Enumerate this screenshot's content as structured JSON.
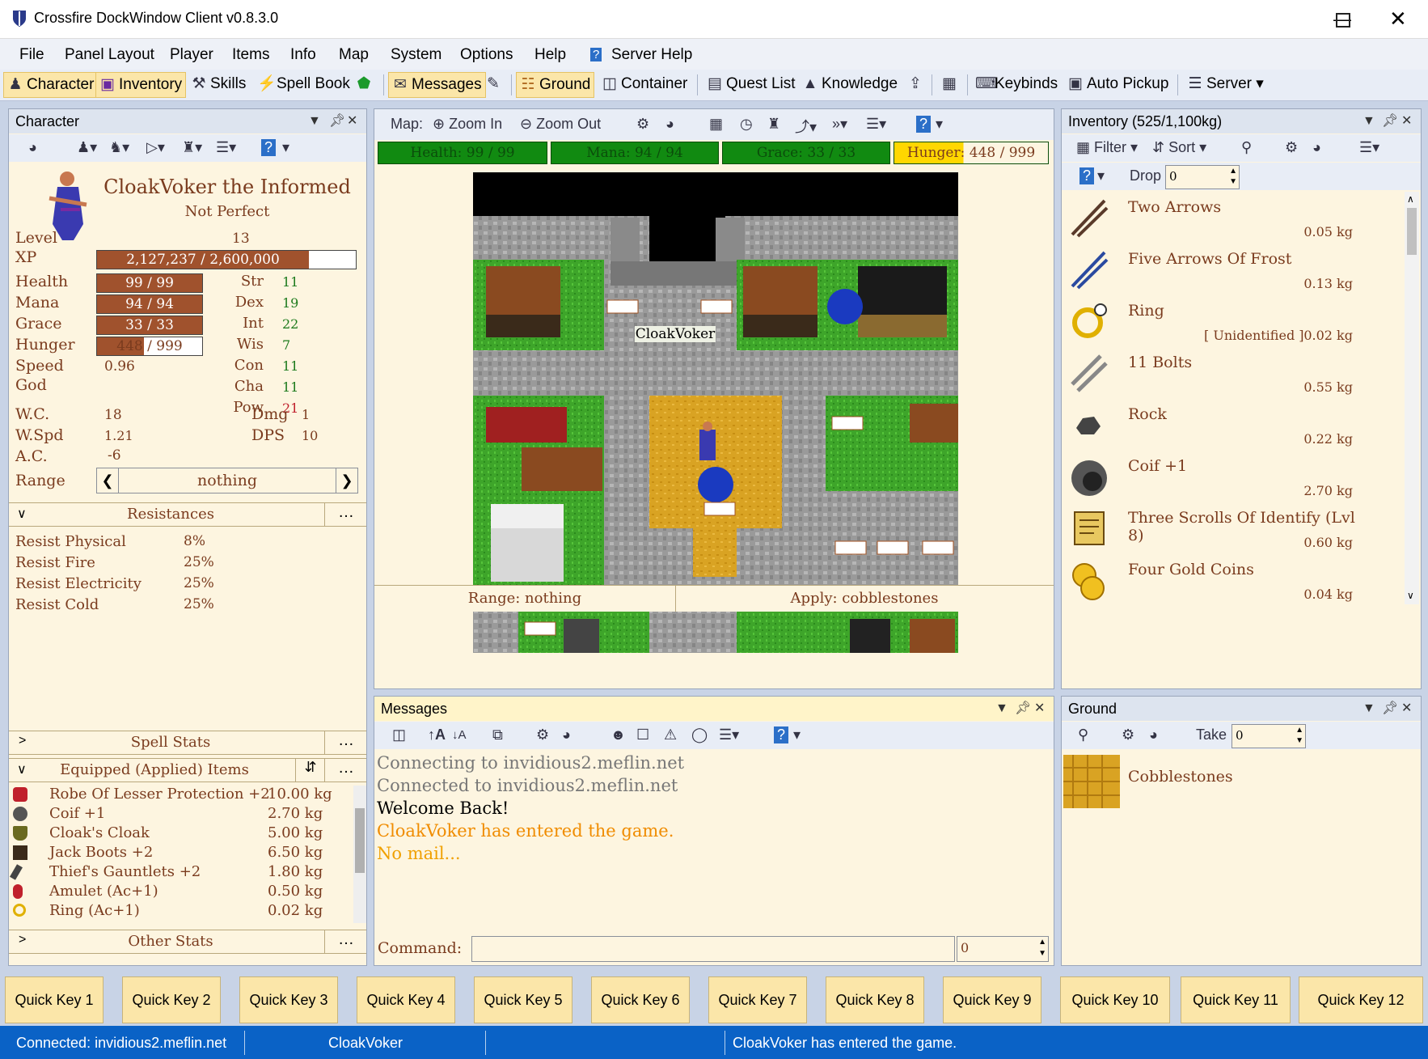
{
  "window": {
    "title": "Crossfire DockWindow Client v0.8.3.0"
  },
  "menu": [
    "File",
    "Panel Layout",
    "Player",
    "Items",
    "Info",
    "Map",
    "System",
    "Options",
    "Help",
    "Server Help"
  ],
  "toolbar": {
    "character": "Character",
    "inventory": "Inventory",
    "skills": "Skills",
    "spellbook": "Spell Book",
    "messages": "Messages",
    "ground": "Ground",
    "container": "Container",
    "quest": "Quest List",
    "knowledge": "Knowledge",
    "keybinds": "Keybinds",
    "autopickup": "Auto Pickup",
    "server": "Server"
  },
  "character": {
    "panel_title": "Character",
    "name": "CloakVoker the Informed",
    "subtitle": "Not Perfect",
    "level_label": "Level",
    "level": "13",
    "xp_label": "XP",
    "xp": "2,127,237 / 2,600,000",
    "xp_fraction": 0.818,
    "health_label": "Health",
    "health": "99 / 99",
    "health_fraction": 1.0,
    "mana_label": "Mana",
    "mana": "94 / 94",
    "mana_fraction": 1.0,
    "grace_label": "Grace",
    "grace": "33 / 33",
    "grace_fraction": 1.0,
    "hunger_label": "Hunger",
    "hunger": "448 / 999",
    "hunger_fraction": 0.448,
    "speed_label": "Speed",
    "speed": "0.96",
    "god_label": "God",
    "stats": [
      {
        "label": "Str",
        "value": "11"
      },
      {
        "label": "Dex",
        "value": "19"
      },
      {
        "label": "Int",
        "value": "22"
      },
      {
        "label": "Wis",
        "value": "7"
      },
      {
        "label": "Con",
        "value": "11"
      },
      {
        "label": "Cha",
        "value": "11"
      },
      {
        "label": "Pow",
        "value": "21"
      }
    ],
    "wc_label": "W.C.",
    "wc": "18",
    "wspd_label": "W.Spd",
    "wspd": "1.21",
    "ac_label": "A.C.",
    "ac": "-6",
    "dmg_label": "Dmg",
    "dmg": "1",
    "dps_label": "DPS",
    "dps": "10",
    "range_label": "Range",
    "range": "nothing",
    "resistances_title": "Resistances",
    "resistances": [
      {
        "name": "Resist Physical",
        "value": "8%"
      },
      {
        "name": "Resist Fire",
        "value": "25%"
      },
      {
        "name": "Resist Electricity",
        "value": "25%"
      },
      {
        "name": "Resist Cold",
        "value": "25%"
      }
    ],
    "spell_stats": "Spell Stats",
    "equipped_title": "Equipped (Applied) Items",
    "equipped": [
      {
        "name": "Robe Of Lesser Protection +2",
        "weight": "10.00 kg"
      },
      {
        "name": "Coif +1",
        "weight": "2.70 kg"
      },
      {
        "name": "Cloak's Cloak",
        "weight": "5.00 kg"
      },
      {
        "name": "Jack Boots +2",
        "weight": "6.50 kg"
      },
      {
        "name": "Thief's Gauntlets +2",
        "weight": "1.80 kg"
      },
      {
        "name": "Amulet (Ac+1)",
        "weight": "0.50 kg"
      },
      {
        "name": "Ring (Ac+1)",
        "weight": "0.02 kg"
      }
    ],
    "other_stats": "Other Stats",
    "more": "…"
  },
  "map": {
    "label": "Map:",
    "zoom_in": "Zoom In",
    "zoom_out": "Zoom Out",
    "bars": [
      {
        "label": "Health:",
        "value": "99 / 99"
      },
      {
        "label": "Mana:",
        "value": "94 / 94"
      },
      {
        "label": "Grace:",
        "value": "33 / 33"
      },
      {
        "label": "Hunger:",
        "value": "448 / 999"
      }
    ],
    "player_name": "CloakVoker",
    "range": "Range: nothing",
    "apply": "Apply: cobblestones"
  },
  "messages": {
    "title": "Messages",
    "lines": [
      {
        "text": "Connecting to invidious2.meflin.net",
        "color": "#777777"
      },
      {
        "text": "Connected to invidious2.meflin.net",
        "color": "#777777"
      },
      {
        "text": "Welcome Back!",
        "color": "#000000"
      },
      {
        "text": "CloakVoker has entered the game.",
        "color": "#f08c00"
      },
      {
        "text": "No mail...",
        "color": "#f0a000"
      }
    ],
    "command_label": "Command:",
    "command_count": "0"
  },
  "inventory": {
    "title": "Inventory (525/1,100kg)",
    "filter": "Filter",
    "sort": "Sort",
    "drop": "Drop",
    "drop_count": "0",
    "items": [
      {
        "name": "Two Arrows",
        "weight": "0.05 kg",
        "note": ""
      },
      {
        "name": "Five Arrows Of Frost",
        "weight": "0.13 kg",
        "note": ""
      },
      {
        "name": "Ring",
        "weight": "0.02 kg",
        "note": "[ Unidentified ]"
      },
      {
        "name": "11 Bolts",
        "weight": "0.55 kg",
        "note": ""
      },
      {
        "name": "Rock",
        "weight": "0.22 kg",
        "note": ""
      },
      {
        "name": "Coif +1",
        "weight": "2.70 kg",
        "note": ""
      },
      {
        "name": "Three Scrolls Of Identify (Lvl 8)",
        "weight": "0.60 kg",
        "note": ""
      },
      {
        "name": "Four Gold Coins",
        "weight": "0.04 kg",
        "note": ""
      }
    ]
  },
  "ground": {
    "title": "Ground",
    "take": "Take",
    "take_count": "0",
    "items": [
      {
        "name": "Cobblestones"
      }
    ]
  },
  "quickkeys": [
    "Quick Key 1",
    "Quick Key 2",
    "Quick Key 3",
    "Quick Key 4",
    "Quick Key 5",
    "Quick Key 6",
    "Quick Key 7",
    "Quick Key 8",
    "Quick Key 9",
    "Quick Key 10",
    "Quick Key 11",
    "Quick Key 12"
  ],
  "status": {
    "connected": "Connected: invidious2.meflin.net",
    "player": "CloakVoker",
    "last": "CloakVoker has entered the game."
  },
  "colors": {
    "accent": "#0a62c6",
    "bar": "#a0522d",
    "panel": "#fdf5e0",
    "statbar": "#118a11",
    "hunger_bar": "#ffd700"
  }
}
